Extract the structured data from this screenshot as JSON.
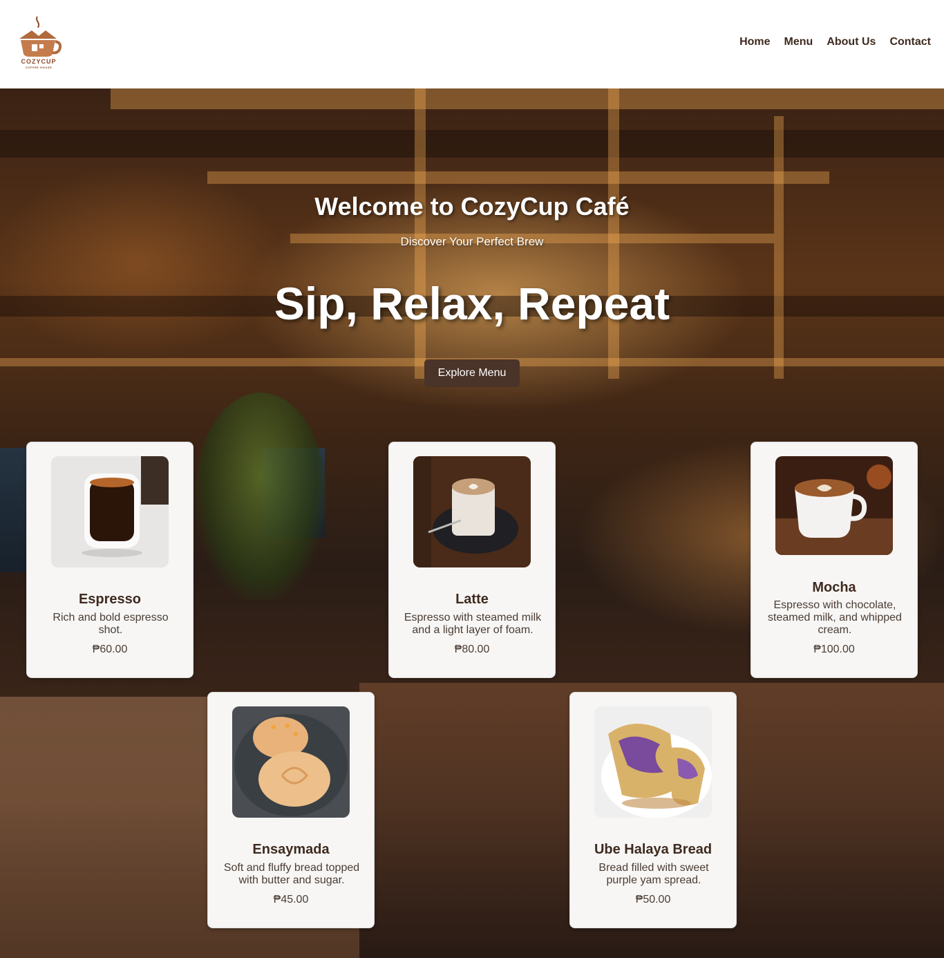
{
  "brand": {
    "logo_name": "COZYCUP",
    "logo_sub": "COFFEE HOUSE",
    "logo_icon": "coffee-house-cup-icon",
    "accent_color": "#8b4a24"
  },
  "nav": {
    "items": [
      {
        "label": "Home"
      },
      {
        "label": "Menu"
      },
      {
        "label": "About Us"
      },
      {
        "label": "Contact"
      }
    ]
  },
  "hero": {
    "title": "Welcome to CozyCup Café",
    "subtitle": "Discover Your Perfect Brew",
    "tagline": "Sip, Relax, Repeat",
    "button_label": "Explore Menu",
    "button_color": "#4a3328"
  },
  "menu": {
    "items": [
      {
        "name": "Espresso",
        "description": "Rich and bold espresso shot.",
        "price": "₱60.00",
        "image": "espresso-cup-image"
      },
      {
        "name": "Latte",
        "description": "Espresso with steamed milk and a light layer of foam.",
        "price": "₱80.00",
        "image": "latte-glass-image"
      },
      {
        "name": "Mocha",
        "description": "Espresso with chocolate, steamed milk, and whipped cream.",
        "price": "₱100.00",
        "image": "mocha-cup-image"
      },
      {
        "name": "Ensaymada",
        "description": "Soft and fluffy bread topped with butter and sugar.",
        "price": "₱45.00",
        "image": "ensaymada-bread-image"
      },
      {
        "name": "Ube Halaya Bread",
        "description": "Bread filled with sweet purple yam spread.",
        "price": "₱50.00",
        "image": "ube-bread-image"
      }
    ]
  }
}
